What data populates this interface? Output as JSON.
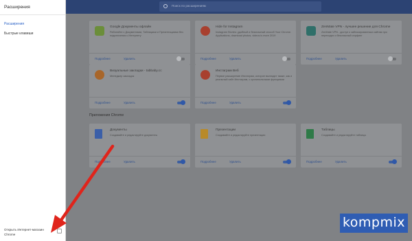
{
  "sidebar": {
    "title": "Расширения",
    "items": [
      {
        "label": "Расширения"
      },
      {
        "label": "Быстрые клавиши"
      }
    ],
    "bottom_link": "Открыть Интернет-магазин Chrome"
  },
  "search": {
    "placeholder": "Поиск по расширениям"
  },
  "extensions": [
    {
      "name": "Google Документы офлайн",
      "desc": "Работайте с Документами, Таблицами и Презентациями без подключения к Интернету",
      "details": "Подробнее",
      "remove": "Удалить",
      "enabled": false,
      "icon": "google-docs-offline-icon",
      "color": "#6b8e3a"
    },
    {
      "name": "Hide for Instagram",
      "desc": "Instagram Stories: удобный и безопасный способ Your Chrome. Applications, download photos, videos is more 2019",
      "details": "Подробнее",
      "remove": "Удалить",
      "enabled": false,
      "icon": "hide-instagram-icon",
      "color": "#a8402f"
    },
    {
      "name": "ZenMate VPN - лучшее решение для Chrome",
      "desc": "ZenMate VPN - доступ к заблокированным сайтам при переходах и безопасный серфинг",
      "details": "Подробнее",
      "remove": "Удалить",
      "enabled": false,
      "icon": "zenmate-icon",
      "color": "#2f6f69"
    },
    {
      "name": "Визуальные закладки - tabbaby.cc",
      "desc": "Менеджер закладок",
      "details": "Подробнее",
      "remove": "Удалить",
      "enabled": true,
      "icon": "visual-bookmarks-icon",
      "color": "#a8662a"
    },
    {
      "name": "Инстаграм Веб",
      "desc": "Первое расширение Инстаграм, которое выглядит также, как и реальный сайт Инстаграм, с оригинальными функциями",
      "details": "Подробнее",
      "remove": "Удалить",
      "enabled": true,
      "icon": "instagram-web-icon",
      "color": "#a8402f"
    }
  ],
  "apps_section": {
    "title": "Приложения Chrome"
  },
  "apps": [
    {
      "name": "Документы",
      "desc": "Создавайте и редактируйте документы",
      "details": "Подробнее",
      "remove": "Удалить",
      "enabled": true,
      "icon": "docs-app-icon",
      "color": "#3b5fa8"
    },
    {
      "name": "Презентации",
      "desc": "Создавайте и редактируйте презентации",
      "details": "Подробнее",
      "remove": "Удалить",
      "enabled": true,
      "icon": "slides-app-icon",
      "color": "#b88a2a"
    },
    {
      "name": "Таблицы",
      "desc": "Создавайте и редактируйте таблицы",
      "details": "Подробнее",
      "remove": "Удалить",
      "enabled": true,
      "icon": "sheets-app-icon",
      "color": "#2f7a48"
    }
  ],
  "watermark": "kompmix",
  "colors": {
    "accent": "#2f58a8",
    "arrow": "#e0241b",
    "watermark_bg": "#2f5db3"
  }
}
